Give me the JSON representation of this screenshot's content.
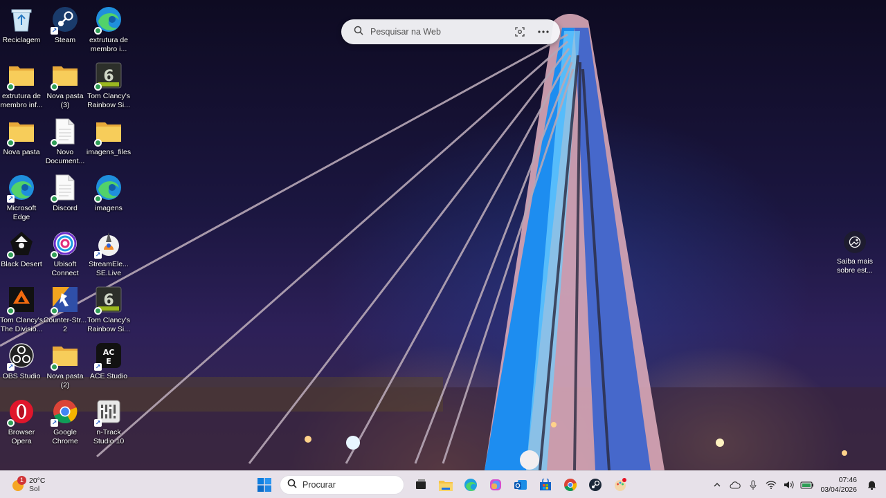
{
  "desktop_icons": [
    {
      "label": "Reciclagem",
      "icon": "recycle-bin-icon",
      "badge": "none"
    },
    {
      "label": "Steam",
      "icon": "steam-icon",
      "badge": "shortcut"
    },
    {
      "label": "extrutura de membro i...",
      "icon": "edge-icon",
      "badge": "check"
    },
    {
      "label": "extrutura de membro inf...",
      "icon": "folder-icon",
      "badge": "check"
    },
    {
      "label": "Nova pasta (3)",
      "icon": "folder-icon",
      "badge": "check"
    },
    {
      "label": "Tom Clancy's Rainbow Si...",
      "icon": "rainbow-six-icon",
      "badge": "check"
    },
    {
      "label": "Nova pasta",
      "icon": "folder-icon",
      "badge": "check"
    },
    {
      "label": "Novo Document...",
      "icon": "document-icon",
      "badge": "check"
    },
    {
      "label": "imagens_files",
      "icon": "folder-icon",
      "badge": "check"
    },
    {
      "label": "Microsoft Edge",
      "icon": "edge-icon",
      "badge": "shortcut"
    },
    {
      "label": "Discord",
      "icon": "document-icon",
      "badge": "check"
    },
    {
      "label": "imagens",
      "icon": "edge-icon",
      "badge": "check"
    },
    {
      "label": "Black Desert",
      "icon": "black-desert-icon",
      "badge": "check"
    },
    {
      "label": "Ubisoft Connect",
      "icon": "ubisoft-icon",
      "badge": "check"
    },
    {
      "label": "StreamEle... SE.Live",
      "icon": "streamelements-icon",
      "badge": "shortcut"
    },
    {
      "label": "Tom Clancy's The Divisio...",
      "icon": "division-icon",
      "badge": "check"
    },
    {
      "label": "Counter-Str... 2",
      "icon": "counter-strike-icon",
      "badge": "check"
    },
    {
      "label": "Tom Clancy's Rainbow Si...",
      "icon": "rainbow-six-icon",
      "badge": "check"
    },
    {
      "label": "OBS Studio",
      "icon": "obs-icon",
      "badge": "shortcut"
    },
    {
      "label": "Nova pasta (2)",
      "icon": "folder-icon",
      "badge": "check"
    },
    {
      "label": "ACE Studio",
      "icon": "ace-studio-icon",
      "badge": "shortcut"
    },
    {
      "label": "Browser Opera",
      "icon": "opera-icon",
      "badge": "check"
    },
    {
      "label": "Google Chrome",
      "icon": "chrome-icon",
      "badge": "shortcut"
    },
    {
      "label": "n-Track Studio 10",
      "icon": "ntrack-icon",
      "badge": "shortcut"
    }
  ],
  "web_search": {
    "placeholder": "Pesquisar na Web"
  },
  "spotlight": {
    "label": "Saiba mais sobre est..."
  },
  "taskbar": {
    "weather": {
      "temp": "20°C",
      "condition": "Sol",
      "alert_count": "1"
    },
    "search_placeholder": "Procurar",
    "apps": [
      "windows-start",
      "task-view",
      "file-explorer",
      "edge",
      "copilot",
      "outlook",
      "microsoft-store",
      "chrome",
      "steam",
      "paint"
    ],
    "clock": {
      "time": "07:46",
      "date": "03/04/2026"
    }
  },
  "colors": {
    "taskbar_bg": "#eee8f0",
    "accent": "#0078d4",
    "folder": "#f6c344"
  }
}
